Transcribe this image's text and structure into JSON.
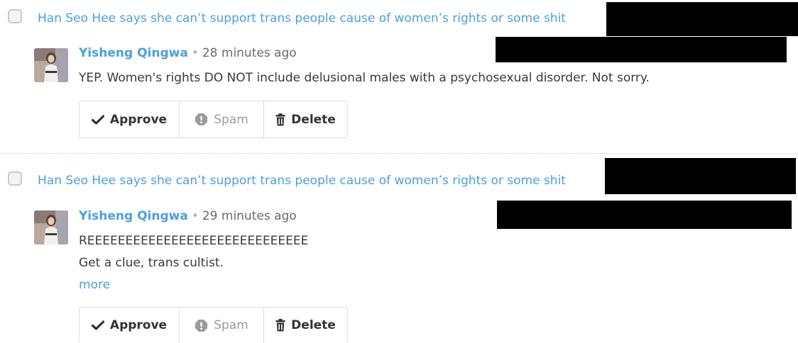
{
  "comments": [
    {
      "thread_title": "Han Seo Hee says she can’t support trans people cause of women’s rights or some shit",
      "author": "Yisheng Qingwa",
      "separator": "•",
      "time": "28 minutes ago",
      "lines": [
        "YEP. Women's rights DO NOT include delusional males with a psychosexual disorder. Not sorry."
      ],
      "more_label": "",
      "actions": {
        "approve": "Approve",
        "spam": "Spam",
        "delete": "Delete"
      }
    },
    {
      "thread_title": "Han Seo Hee says she can’t support trans people cause of women’s rights or some shit",
      "author": "Yisheng Qingwa",
      "separator": "•",
      "time": "29 minutes ago",
      "lines": [
        "REEEEEEEEEEEEEEEEEEEEEEEEEEEEE",
        "Get a clue, trans cultist."
      ],
      "more_label": "more",
      "actions": {
        "approve": "Approve",
        "spam": "Spam",
        "delete": "Delete"
      }
    }
  ],
  "icons": {
    "approve": "checkmark-icon",
    "spam": "alert-octagon-icon",
    "delete": "trash-icon"
  },
  "colors": {
    "link": "#4a9fe0",
    "redaction": "#000000",
    "muted": "#9a9a9a"
  }
}
